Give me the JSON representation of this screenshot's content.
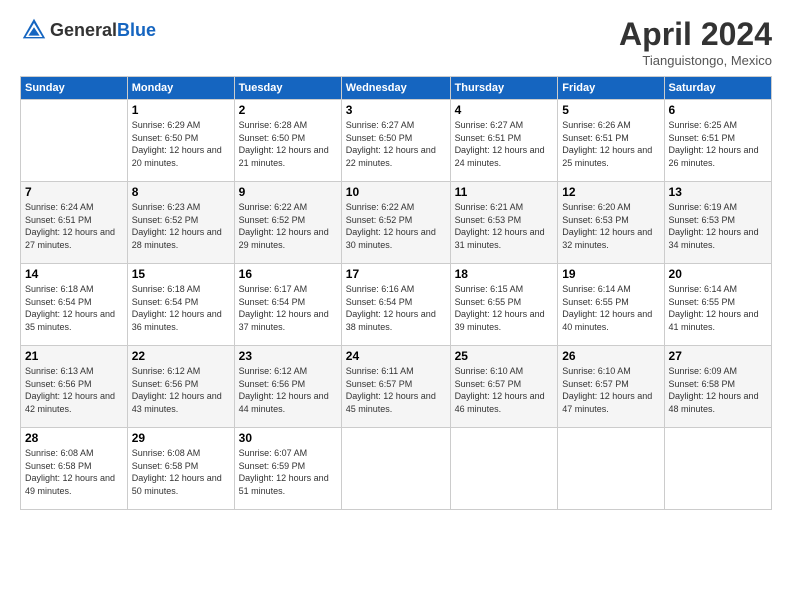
{
  "header": {
    "logo_general": "General",
    "logo_blue": "Blue",
    "month_title": "April 2024",
    "location": "Tianguistongo, Mexico"
  },
  "days_of_week": [
    "Sunday",
    "Monday",
    "Tuesday",
    "Wednesday",
    "Thursday",
    "Friday",
    "Saturday"
  ],
  "weeks": [
    [
      {
        "day": "",
        "sunrise": "",
        "sunset": "",
        "daylight": ""
      },
      {
        "day": "1",
        "sunrise": "Sunrise: 6:29 AM",
        "sunset": "Sunset: 6:50 PM",
        "daylight": "Daylight: 12 hours and 20 minutes."
      },
      {
        "day": "2",
        "sunrise": "Sunrise: 6:28 AM",
        "sunset": "Sunset: 6:50 PM",
        "daylight": "Daylight: 12 hours and 21 minutes."
      },
      {
        "day": "3",
        "sunrise": "Sunrise: 6:27 AM",
        "sunset": "Sunset: 6:50 PM",
        "daylight": "Daylight: 12 hours and 22 minutes."
      },
      {
        "day": "4",
        "sunrise": "Sunrise: 6:27 AM",
        "sunset": "Sunset: 6:51 PM",
        "daylight": "Daylight: 12 hours and 24 minutes."
      },
      {
        "day": "5",
        "sunrise": "Sunrise: 6:26 AM",
        "sunset": "Sunset: 6:51 PM",
        "daylight": "Daylight: 12 hours and 25 minutes."
      },
      {
        "day": "6",
        "sunrise": "Sunrise: 6:25 AM",
        "sunset": "Sunset: 6:51 PM",
        "daylight": "Daylight: 12 hours and 26 minutes."
      }
    ],
    [
      {
        "day": "7",
        "sunrise": "Sunrise: 6:24 AM",
        "sunset": "Sunset: 6:51 PM",
        "daylight": "Daylight: 12 hours and 27 minutes."
      },
      {
        "day": "8",
        "sunrise": "Sunrise: 6:23 AM",
        "sunset": "Sunset: 6:52 PM",
        "daylight": "Daylight: 12 hours and 28 minutes."
      },
      {
        "day": "9",
        "sunrise": "Sunrise: 6:22 AM",
        "sunset": "Sunset: 6:52 PM",
        "daylight": "Daylight: 12 hours and 29 minutes."
      },
      {
        "day": "10",
        "sunrise": "Sunrise: 6:22 AM",
        "sunset": "Sunset: 6:52 PM",
        "daylight": "Daylight: 12 hours and 30 minutes."
      },
      {
        "day": "11",
        "sunrise": "Sunrise: 6:21 AM",
        "sunset": "Sunset: 6:53 PM",
        "daylight": "Daylight: 12 hours and 31 minutes."
      },
      {
        "day": "12",
        "sunrise": "Sunrise: 6:20 AM",
        "sunset": "Sunset: 6:53 PM",
        "daylight": "Daylight: 12 hours and 32 minutes."
      },
      {
        "day": "13",
        "sunrise": "Sunrise: 6:19 AM",
        "sunset": "Sunset: 6:53 PM",
        "daylight": "Daylight: 12 hours and 34 minutes."
      }
    ],
    [
      {
        "day": "14",
        "sunrise": "Sunrise: 6:18 AM",
        "sunset": "Sunset: 6:54 PM",
        "daylight": "Daylight: 12 hours and 35 minutes."
      },
      {
        "day": "15",
        "sunrise": "Sunrise: 6:18 AM",
        "sunset": "Sunset: 6:54 PM",
        "daylight": "Daylight: 12 hours and 36 minutes."
      },
      {
        "day": "16",
        "sunrise": "Sunrise: 6:17 AM",
        "sunset": "Sunset: 6:54 PM",
        "daylight": "Daylight: 12 hours and 37 minutes."
      },
      {
        "day": "17",
        "sunrise": "Sunrise: 6:16 AM",
        "sunset": "Sunset: 6:54 PM",
        "daylight": "Daylight: 12 hours and 38 minutes."
      },
      {
        "day": "18",
        "sunrise": "Sunrise: 6:15 AM",
        "sunset": "Sunset: 6:55 PM",
        "daylight": "Daylight: 12 hours and 39 minutes."
      },
      {
        "day": "19",
        "sunrise": "Sunrise: 6:14 AM",
        "sunset": "Sunset: 6:55 PM",
        "daylight": "Daylight: 12 hours and 40 minutes."
      },
      {
        "day": "20",
        "sunrise": "Sunrise: 6:14 AM",
        "sunset": "Sunset: 6:55 PM",
        "daylight": "Daylight: 12 hours and 41 minutes."
      }
    ],
    [
      {
        "day": "21",
        "sunrise": "Sunrise: 6:13 AM",
        "sunset": "Sunset: 6:56 PM",
        "daylight": "Daylight: 12 hours and 42 minutes."
      },
      {
        "day": "22",
        "sunrise": "Sunrise: 6:12 AM",
        "sunset": "Sunset: 6:56 PM",
        "daylight": "Daylight: 12 hours and 43 minutes."
      },
      {
        "day": "23",
        "sunrise": "Sunrise: 6:12 AM",
        "sunset": "Sunset: 6:56 PM",
        "daylight": "Daylight: 12 hours and 44 minutes."
      },
      {
        "day": "24",
        "sunrise": "Sunrise: 6:11 AM",
        "sunset": "Sunset: 6:57 PM",
        "daylight": "Daylight: 12 hours and 45 minutes."
      },
      {
        "day": "25",
        "sunrise": "Sunrise: 6:10 AM",
        "sunset": "Sunset: 6:57 PM",
        "daylight": "Daylight: 12 hours and 46 minutes."
      },
      {
        "day": "26",
        "sunrise": "Sunrise: 6:10 AM",
        "sunset": "Sunset: 6:57 PM",
        "daylight": "Daylight: 12 hours and 47 minutes."
      },
      {
        "day": "27",
        "sunrise": "Sunrise: 6:09 AM",
        "sunset": "Sunset: 6:58 PM",
        "daylight": "Daylight: 12 hours and 48 minutes."
      }
    ],
    [
      {
        "day": "28",
        "sunrise": "Sunrise: 6:08 AM",
        "sunset": "Sunset: 6:58 PM",
        "daylight": "Daylight: 12 hours and 49 minutes."
      },
      {
        "day": "29",
        "sunrise": "Sunrise: 6:08 AM",
        "sunset": "Sunset: 6:58 PM",
        "daylight": "Daylight: 12 hours and 50 minutes."
      },
      {
        "day": "30",
        "sunrise": "Sunrise: 6:07 AM",
        "sunset": "Sunset: 6:59 PM",
        "daylight": "Daylight: 12 hours and 51 minutes."
      },
      {
        "day": "",
        "sunrise": "",
        "sunset": "",
        "daylight": ""
      },
      {
        "day": "",
        "sunrise": "",
        "sunset": "",
        "daylight": ""
      },
      {
        "day": "",
        "sunrise": "",
        "sunset": "",
        "daylight": ""
      },
      {
        "day": "",
        "sunrise": "",
        "sunset": "",
        "daylight": ""
      }
    ]
  ]
}
